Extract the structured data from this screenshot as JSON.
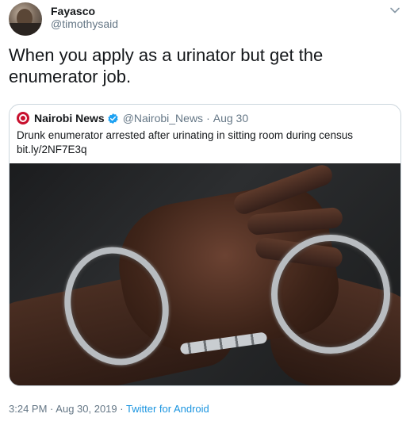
{
  "author": {
    "name": "Fayasco",
    "handle": "@timothysaid"
  },
  "tweet": {
    "text": "When you apply as a urinator but get the enumerator job."
  },
  "quoted": {
    "name": "Nairobi News",
    "handle": "@Nairobi_News",
    "separator": "·",
    "date": "Aug 30",
    "text": "Drunk enumerator arrested after urinating in sitting room during census",
    "link": "bit.ly/2NF7E3q",
    "brand_color": "#c8102e"
  },
  "meta": {
    "time": "3:24 PM",
    "separator": "·",
    "date": "Aug 30, 2019",
    "separator2": "·",
    "source": "Twitter for Android"
  },
  "icons": {
    "menu": "chevron-down-icon",
    "verified": "verified-badge-icon",
    "quoted_logo": "nairobi-news-logo"
  },
  "colors": {
    "link": "#1b95e0",
    "secondary_text": "#657786",
    "verified": "#1da1f2"
  }
}
